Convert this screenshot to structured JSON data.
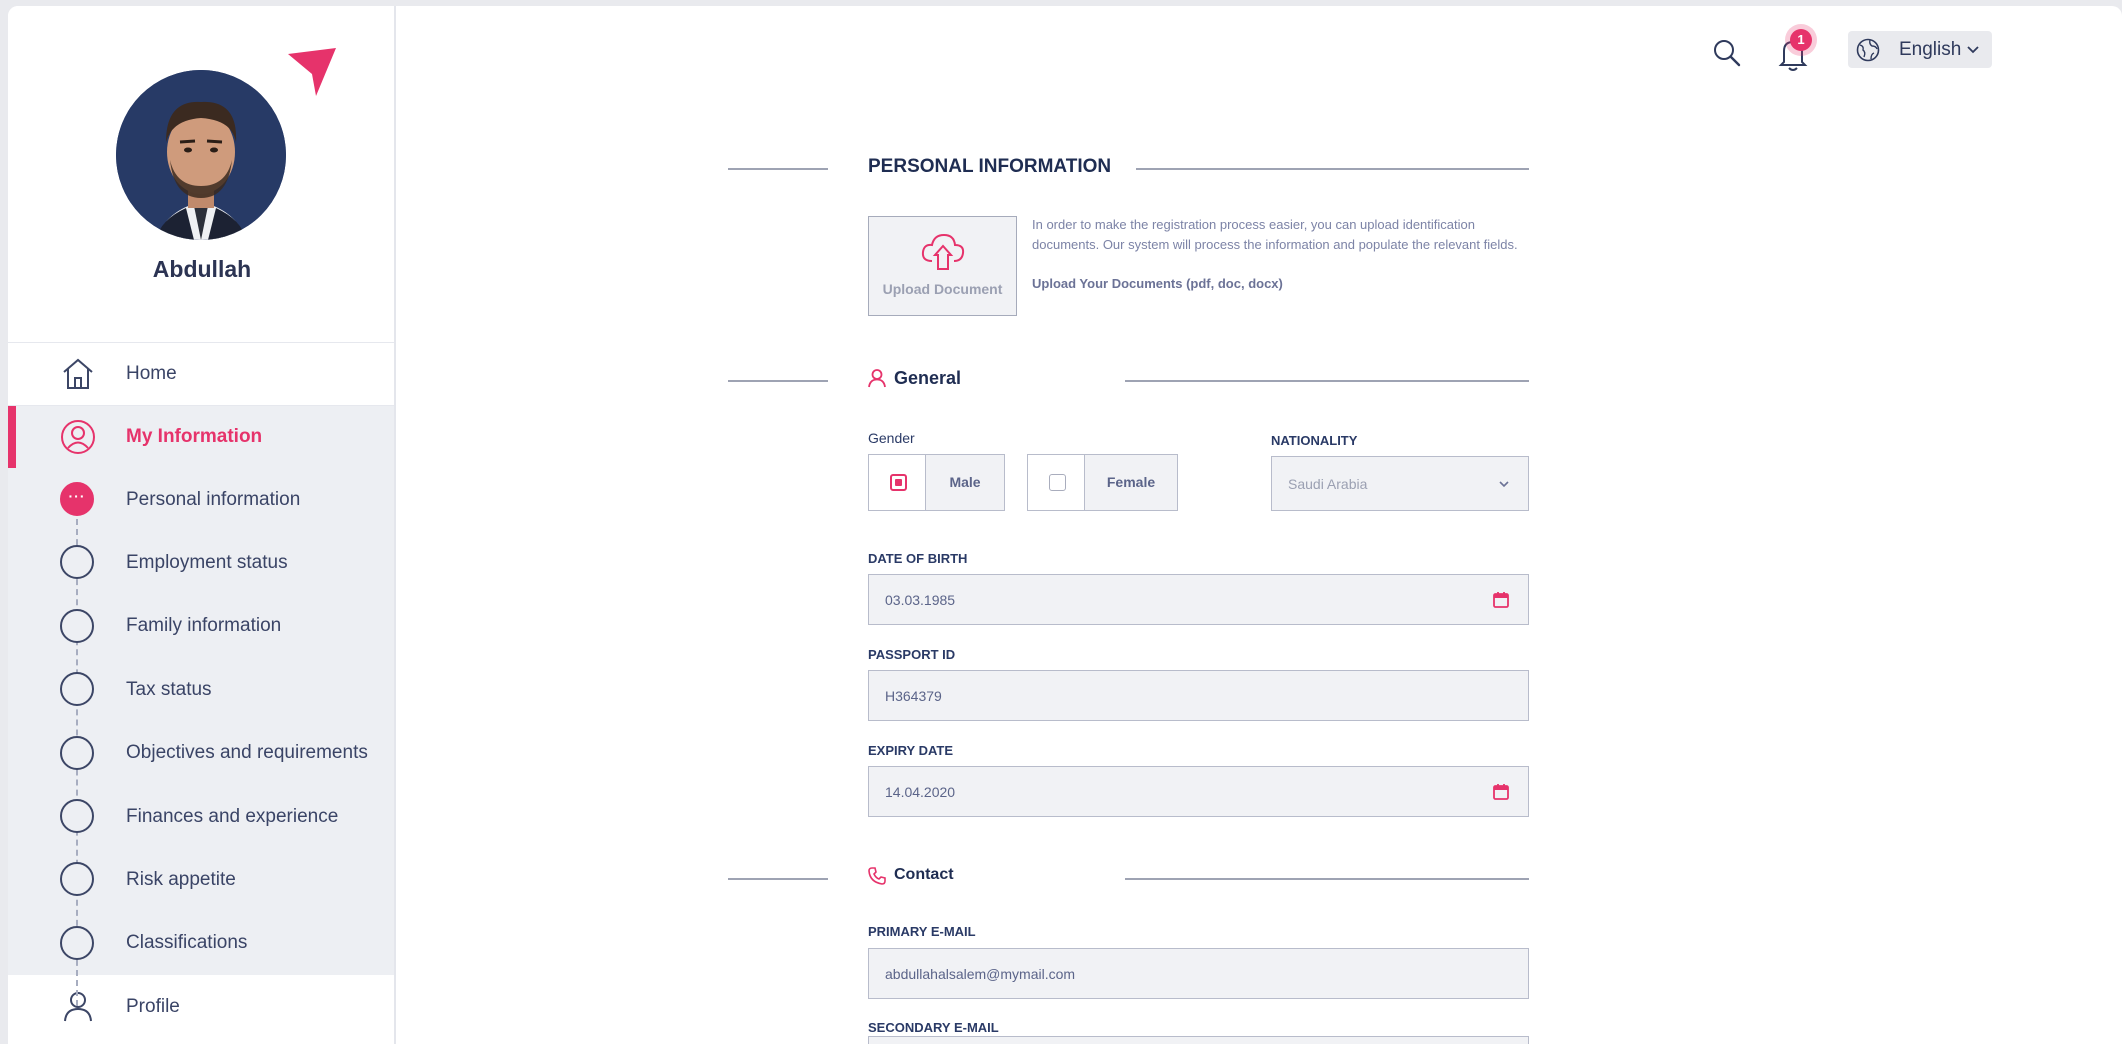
{
  "user": {
    "name": "Abdullah"
  },
  "nav": {
    "home": "Home",
    "my_information": "My Information",
    "steps": [
      {
        "label": "Personal information",
        "current": true
      },
      {
        "label": "Employment status"
      },
      {
        "label": "Family information"
      },
      {
        "label": "Tax status"
      },
      {
        "label": "Objectives and requirements"
      },
      {
        "label": "Finances and experience"
      },
      {
        "label": "Risk appetite"
      },
      {
        "label": "Classifications"
      }
    ],
    "current_step_dots": "···",
    "profile": "Profile"
  },
  "topbar": {
    "notification_count": "1",
    "language": "English"
  },
  "personal_information": {
    "title": "PERSONAL INFORMATION",
    "upload_label": "Upload Document",
    "upload_description": "In order to make the registration process easier, you can upload identification documents. Our system will process the information and populate the relevant fields.",
    "upload_formats": "Upload Your Documents (pdf, doc, docx)"
  },
  "general": {
    "title": "General",
    "gender_label": "Gender",
    "gender_options": [
      "Male",
      "Female"
    ],
    "gender_selected": "Male",
    "nationality_label": "NATIONALITY",
    "nationality_value": "Saudi Arabia",
    "dob_label": "DATE OF BIRTH",
    "dob_value": "03.03.1985",
    "passport_label": "PASSPORT ID",
    "passport_value": "H364379",
    "expiry_label": "EXPIRY DATE",
    "expiry_value": "14.04.2020"
  },
  "contact": {
    "title": "Contact",
    "primary_email_label": "PRIMARY E-MAIL",
    "primary_email_value": "abdullahalsalem@mymail.com",
    "secondary_email_label": "SECONDARY E-MAIL"
  },
  "colors": {
    "accent": "#e6336b",
    "navy": "#273a66",
    "text": "#2f3a5c",
    "panel": "#edeff3"
  },
  "icons": {
    "brand": "paper-plane-icon",
    "home": "home-icon",
    "my_information": "user-circle-icon",
    "profile": "user-icon",
    "search": "search-icon",
    "bell": "bell-icon",
    "globe": "globe-icon",
    "upload": "cloud-upload-icon",
    "calendar": "calendar-icon",
    "phone": "phone-icon"
  }
}
